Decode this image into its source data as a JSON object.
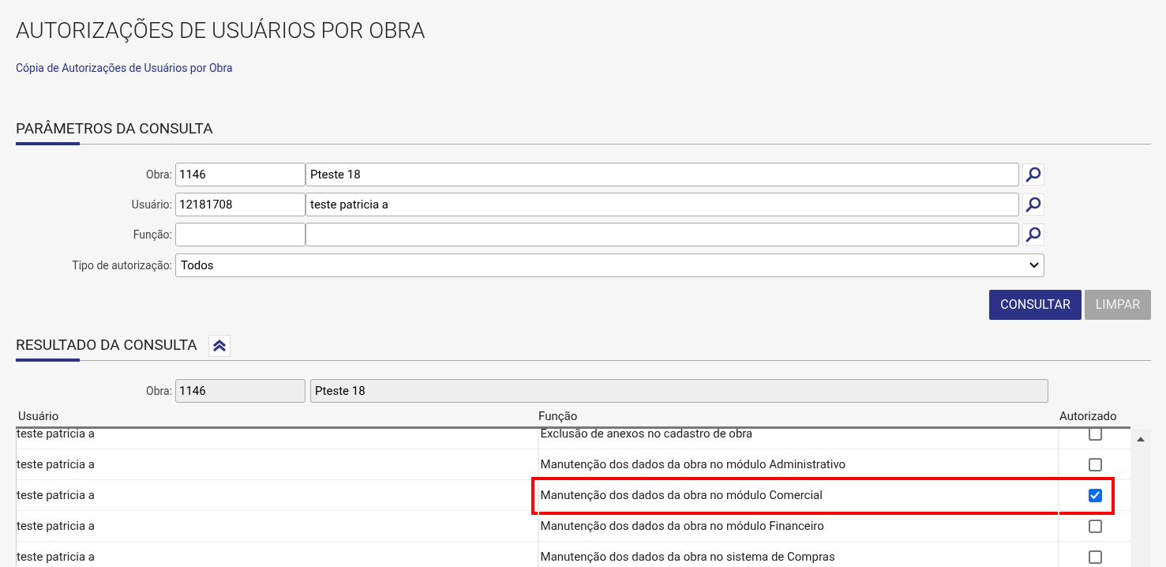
{
  "page": {
    "title": "AUTORIZAÇÕES DE USUÁRIOS POR OBRA",
    "subtitle": "Cópia de Autorizações de Usuários por Obra"
  },
  "params": {
    "title": "PARÂMETROS DA CONSULTA",
    "fields": [
      {
        "label": "Obra:",
        "code": "1146",
        "name": "Pteste 18"
      },
      {
        "label": "Usuário:",
        "code": "12181708",
        "name": "teste patricia a"
      },
      {
        "label": "Função:"
      }
    ],
    "select": {
      "label": "Tipo de autorização:",
      "value": "Todos"
    },
    "buttons": [
      {
        "label": "CONSULTAR",
        "disabled": false
      },
      {
        "label": "LIMPAR",
        "disabled": true
      }
    ]
  },
  "result": {
    "title": "RESULTADO DA CONSULTA",
    "expanded": true,
    "obra": {
      "label": "Obra:",
      "code": "1146",
      "name": "Pteste 18"
    },
    "columns": [
      "Usuário",
      "Função",
      "Autorizado"
    ],
    "rows": [
      {
        "user": "teste patricia a",
        "function": "Exclusão de anexos no cadastro de obra",
        "checked": false,
        "highlighted": false
      },
      {
        "user": "teste patricia a",
        "function": "Manutenção dos dados da obra no módulo Administrativo",
        "checked": false,
        "highlighted": false
      },
      {
        "user": "teste patricia a",
        "function": "Manutenção dos dados da obra no módulo Comercial",
        "checked": true,
        "highlighted": true
      },
      {
        "user": "teste patricia a",
        "function": "Manutenção dos dados da obra no módulo Financeiro",
        "checked": false,
        "highlighted": false
      },
      {
        "user": "teste patricia a",
        "function": "Manutenção dos dados da obra no sistema de Compras",
        "checked": false,
        "highlighted": false
      }
    ]
  }
}
